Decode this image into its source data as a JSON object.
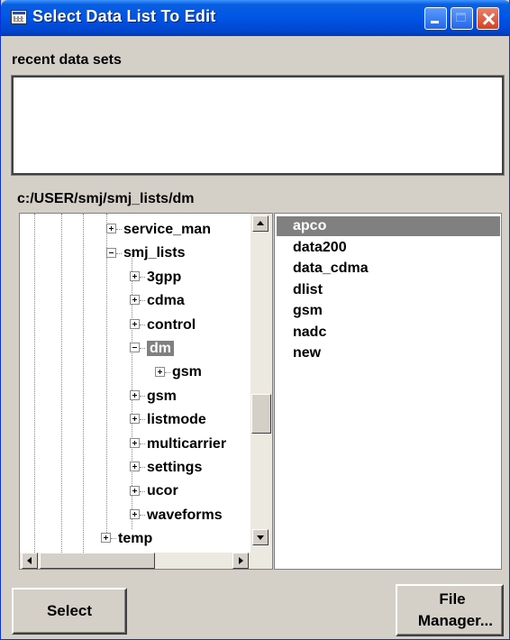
{
  "window": {
    "title": "Select Data List To Edit",
    "icon": "data-list-window-icon",
    "controls": [
      "minimize-icon",
      "maximize-icon",
      "close-icon"
    ]
  },
  "recent": {
    "label": "recent data sets",
    "items": []
  },
  "path": {
    "label": "c:/USER/smj/smj_lists/dm"
  },
  "tree": {
    "items": [
      {
        "label": "service_man",
        "level": 0,
        "expander": "plus"
      },
      {
        "label": "smj_lists",
        "level": 0,
        "expander": "minus"
      },
      {
        "label": "3gpp",
        "level": 1,
        "expander": "plus"
      },
      {
        "label": "cdma",
        "level": 1,
        "expander": "plus"
      },
      {
        "label": "control",
        "level": 1,
        "expander": "plus"
      },
      {
        "label": "dm",
        "level": 1,
        "expander": "minus",
        "selected": true
      },
      {
        "label": "gsm",
        "level": 2,
        "expander": "plus"
      },
      {
        "label": "gsm",
        "level": 1,
        "expander": "plus"
      },
      {
        "label": "listmode",
        "level": 1,
        "expander": "plus"
      },
      {
        "label": "multicarrier",
        "level": 1,
        "expander": "plus"
      },
      {
        "label": "settings",
        "level": 1,
        "expander": "plus"
      },
      {
        "label": "ucor",
        "level": 1,
        "expander": "plus"
      },
      {
        "label": "waveforms",
        "level": 1,
        "expander": "plus"
      },
      {
        "label": "temp",
        "level": -1,
        "expander": "plus"
      }
    ]
  },
  "files": {
    "items": [
      "apco",
      "data200",
      "data_cdma",
      "dlist",
      "gsm",
      "nadc",
      "new"
    ],
    "selected": "apco"
  },
  "buttons": {
    "select_label": "Select",
    "file_manager_line1": "File",
    "file_manager_line2": "Manager..."
  },
  "colors": {
    "titlebar": "#0055e5",
    "selection": "#808080",
    "window_bg": "#d4d0c8"
  }
}
